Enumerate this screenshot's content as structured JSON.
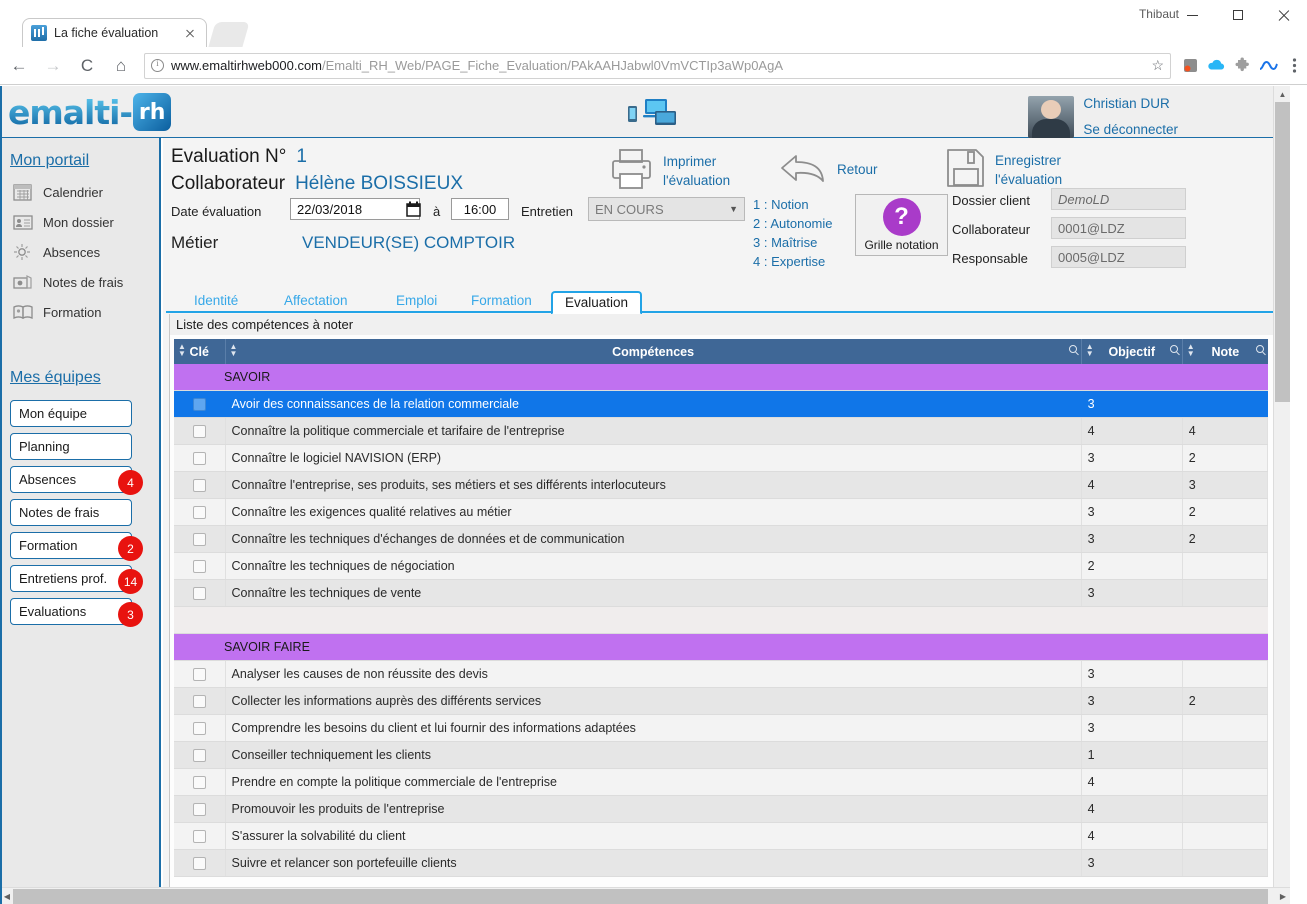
{
  "browser": {
    "tab_title": "La fiche évaluation",
    "url_host": "www.emaltirhweb000.com",
    "url_path": "/Emalti_RH_Web/PAGE_Fiche_Evaluation/PAkAAHJabwl0VmVCTIp3aWp0AgA",
    "profile_name": "Thibaut",
    "back_glyph": "←",
    "forward_glyph": "→",
    "reload_glyph": "C",
    "home_glyph": "⌂",
    "star_glyph": "☆"
  },
  "appheader": {
    "logo_text": "emalti-",
    "logo_badge": "rh",
    "user_name": "Christian DUR",
    "logout_label": "Se déconnecter"
  },
  "sidebar": {
    "portal_heading": "Mon portail",
    "portal_items": [
      {
        "label": "Calendrier"
      },
      {
        "label": "Mon dossier"
      },
      {
        "label": "Absences"
      },
      {
        "label": "Notes de frais"
      },
      {
        "label": "Formation"
      }
    ],
    "teams_heading": "Mes équipes",
    "team_buttons": [
      {
        "label": "Mon équipe",
        "badge": ""
      },
      {
        "label": "Planning",
        "badge": ""
      },
      {
        "label": "Absences",
        "badge": "4"
      },
      {
        "label": "Notes de frais",
        "badge": ""
      },
      {
        "label": "Formation",
        "badge": "2"
      },
      {
        "label": "Entretiens prof.",
        "badge": "14"
      },
      {
        "label": "Evaluations",
        "badge": "3"
      }
    ]
  },
  "main": {
    "eval_label": "Evaluation N°",
    "eval_number": "1",
    "collaborateur_label": "Collaborateur",
    "collaborateur_value": "Hélène BOISSIEUX",
    "toolbar": {
      "print_line1": "Imprimer",
      "print_line2": "l'évaluation",
      "back_label": "Retour",
      "save_line1": "Enregistrer",
      "save_line2": "l'évaluation"
    },
    "form": {
      "date_label": "Date évaluation",
      "date_value": "22/03/2018",
      "at_label": "à",
      "time_value": "16:00",
      "entretien_label": "Entretien",
      "entretien_value": "EN COURS",
      "metier_label": "Métier",
      "metier_value": "VENDEUR(SE) COMPTOIR"
    },
    "legend": [
      "1 : Notion",
      "2 : Autonomie",
      "3 : Maîtrise",
      "4 : Expertise"
    ],
    "grille": {
      "glyph": "?",
      "label": "Grille notation"
    },
    "right_fields": [
      {
        "label": "Dossier client",
        "value": "DemoLD"
      },
      {
        "label": "Collaborateur",
        "value": "0001@LDZ"
      },
      {
        "label": "Responsable",
        "value": "0005@LDZ"
      }
    ],
    "tabs": [
      {
        "label": "Identité",
        "active": false
      },
      {
        "label": "Affectation",
        "active": false
      },
      {
        "label": "Emploi",
        "active": false
      },
      {
        "label": "Formation",
        "active": false
      },
      {
        "label": "Evaluation",
        "active": true
      }
    ],
    "panel_caption": "Liste des compétences à noter",
    "columns": [
      "Clé",
      "Compétences",
      "Objectif",
      "Note"
    ],
    "rows": [
      {
        "type": "section",
        "label": "SAVOIR"
      },
      {
        "type": "row",
        "selected": true,
        "competence": "Avoir des connaissances de la relation commerciale",
        "objectif": "3",
        "note": ""
      },
      {
        "type": "row",
        "selected": false,
        "competence": "Connaître la politique commerciale et tarifaire de l'entreprise",
        "objectif": "4",
        "note": "4"
      },
      {
        "type": "row",
        "selected": false,
        "competence": "Connaître le logiciel NAVISION (ERP)",
        "objectif": "3",
        "note": "2"
      },
      {
        "type": "row",
        "selected": false,
        "competence": "Connaître l'entreprise, ses produits, ses métiers et ses différents interlocuteurs",
        "objectif": "4",
        "note": "3"
      },
      {
        "type": "row",
        "selected": false,
        "competence": "Connaître les exigences qualité relatives au métier",
        "objectif": "3",
        "note": "2"
      },
      {
        "type": "row",
        "selected": false,
        "competence": "Connaître les techniques d'échanges de données et de communication",
        "objectif": "3",
        "note": "2"
      },
      {
        "type": "row",
        "selected": false,
        "competence": "Connaître les techniques de négociation",
        "objectif": "2",
        "note": ""
      },
      {
        "type": "row",
        "selected": false,
        "competence": "Connaître les techniques de vente",
        "objectif": "3",
        "note": ""
      },
      {
        "type": "spacer"
      },
      {
        "type": "section",
        "label": "SAVOIR FAIRE"
      },
      {
        "type": "row",
        "selected": false,
        "competence": "Analyser les causes de non réussite des devis",
        "objectif": "3",
        "note": ""
      },
      {
        "type": "row",
        "selected": false,
        "competence": "Collecter les informations auprès des différents services",
        "objectif": "3",
        "note": "2"
      },
      {
        "type": "row",
        "selected": false,
        "competence": "Comprendre les besoins du client et lui fournir des informations adaptées",
        "objectif": "3",
        "note": ""
      },
      {
        "type": "row",
        "selected": false,
        "competence": "Conseiller techniquement les clients",
        "objectif": "1",
        "note": ""
      },
      {
        "type": "row",
        "selected": false,
        "competence": "Prendre en compte la politique commerciale de l'entreprise",
        "objectif": "4",
        "note": ""
      },
      {
        "type": "row",
        "selected": false,
        "competence": "Promouvoir les produits de l'entreprise",
        "objectif": "4",
        "note": ""
      },
      {
        "type": "row",
        "selected": false,
        "competence": "S'assurer la solvabilité du client",
        "objectif": "4",
        "note": ""
      },
      {
        "type": "row",
        "selected": false,
        "competence": "Suivre et relancer son portefeuille clients",
        "objectif": "3",
        "note": ""
      }
    ]
  },
  "colors": {
    "accent_blue": "#1b6ea8",
    "tab_blue": "#22a3e6",
    "section_purple": "#c071f0",
    "selected_row": "#1076e8",
    "badge_red": "#e8130f",
    "grid_header": "#3f6796",
    "grille_purple": "#a93bc9"
  }
}
